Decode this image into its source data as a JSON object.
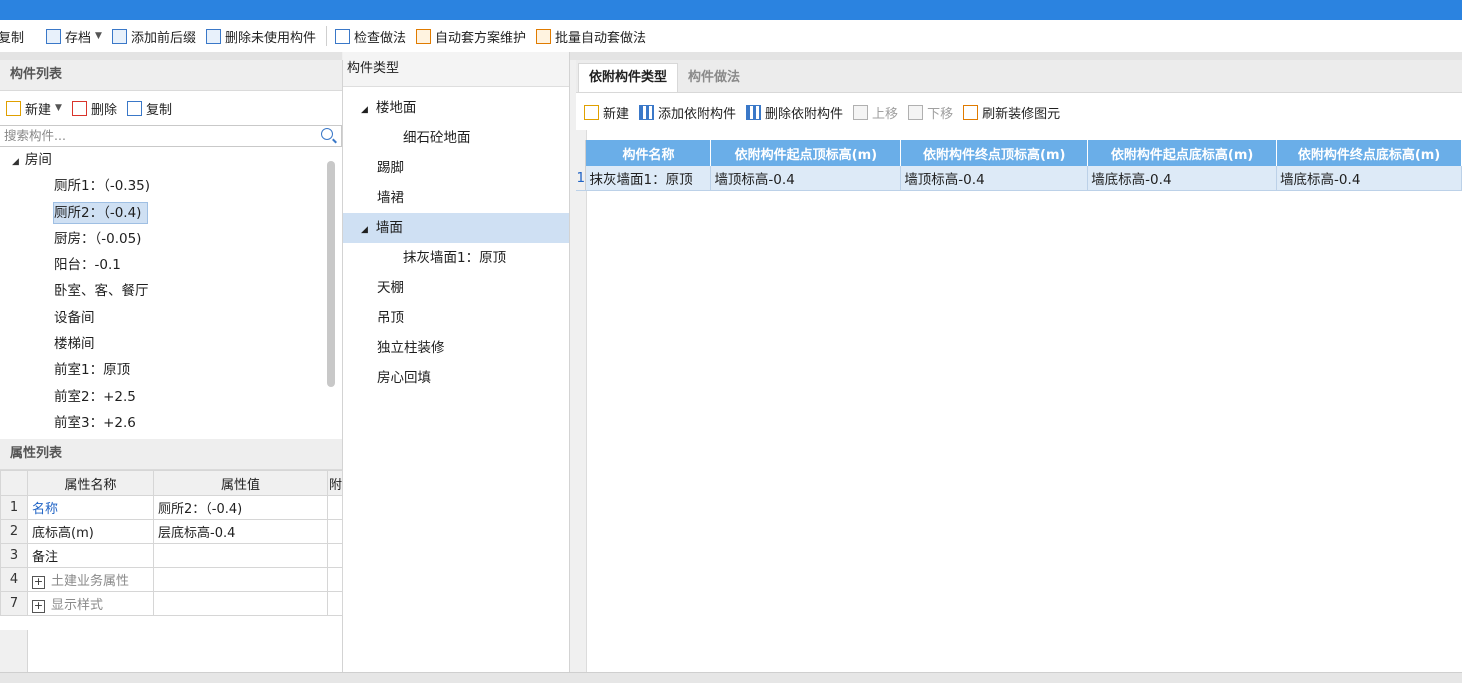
{
  "toolbar": {
    "copy": "复制",
    "archive": "存档",
    "add_prefix_suffix": "添加前后缀",
    "delete_unused": "删除未使用构件",
    "check_method": "检查做法",
    "auto_scheme": "自动套方案维护",
    "batch_auto": "批量自动套做法"
  },
  "left": {
    "title": "构件列表",
    "new": "新建",
    "delete": "删除",
    "copy": "复制",
    "search_placeholder": "搜索构件...",
    "tree": {
      "root": "房间",
      "items": [
        "厕所1：（-0.35)",
        "厕所2：（-0.4)",
        "厨房：（-0.05)",
        "阳台：-0.1",
        "卧室、客、餐厅",
        "设备间",
        "楼梯间",
        "前室1：原顶",
        "前室2：+2.5",
        "前室3：+2.6"
      ],
      "selected_index": 1
    }
  },
  "props": {
    "title": "属性列表",
    "headers": [
      "属性名称",
      "属性值",
      "附"
    ],
    "rows": [
      {
        "idx": "1",
        "name": "名称",
        "value": "厕所2：（-0.4)"
      },
      {
        "idx": "2",
        "name": "底标高(m)",
        "value": "层底标高-0.4"
      },
      {
        "idx": "3",
        "name": "备注",
        "value": ""
      },
      {
        "idx": "4",
        "name": "土建业务属性",
        "value": ""
      },
      {
        "idx": "7",
        "name": "显示样式",
        "value": ""
      }
    ]
  },
  "middle": {
    "title": "构件类型",
    "items": [
      {
        "label": "楼地面",
        "level": 0,
        "expanded": true
      },
      {
        "label": "细石砼地面",
        "level": 1
      },
      {
        "label": "踢脚",
        "level": 0
      },
      {
        "label": "墙裙",
        "level": 0
      },
      {
        "label": "墙面",
        "level": 0,
        "expanded": true,
        "active": true
      },
      {
        "label": "抹灰墙面1：原顶",
        "level": 1
      },
      {
        "label": "天棚",
        "level": 0
      },
      {
        "label": "吊顶",
        "level": 0
      },
      {
        "label": "独立柱装修",
        "level": 0
      },
      {
        "label": "房心回填",
        "level": 0
      }
    ]
  },
  "right": {
    "tabs": [
      "依附构件类型",
      "构件做法"
    ],
    "active_tab": 0,
    "toolbar": {
      "new": "新建",
      "add_attached": "添加依附构件",
      "delete_attached": "删除依附构件",
      "move_up": "上移",
      "move_down": "下移",
      "refresh": "刷新装修图元"
    },
    "table": {
      "headers": [
        "构件名称",
        "依附构件起点顶标高(m)",
        "依附构件终点顶标高(m)",
        "依附构件起点底标高(m)",
        "依附构件终点底标高(m)"
      ],
      "rows": [
        {
          "no": "1",
          "cells": [
            "抹灰墙面1：原顶",
            "墙顶标高-0.4",
            "墙顶标高-0.4",
            "墙底标高-0.4",
            "墙底标高-0.4"
          ]
        }
      ]
    }
  },
  "colors": {
    "titlebar": "#2b83e0",
    "header_blue": "#6aaee8",
    "selection": "#cfe0f3"
  }
}
